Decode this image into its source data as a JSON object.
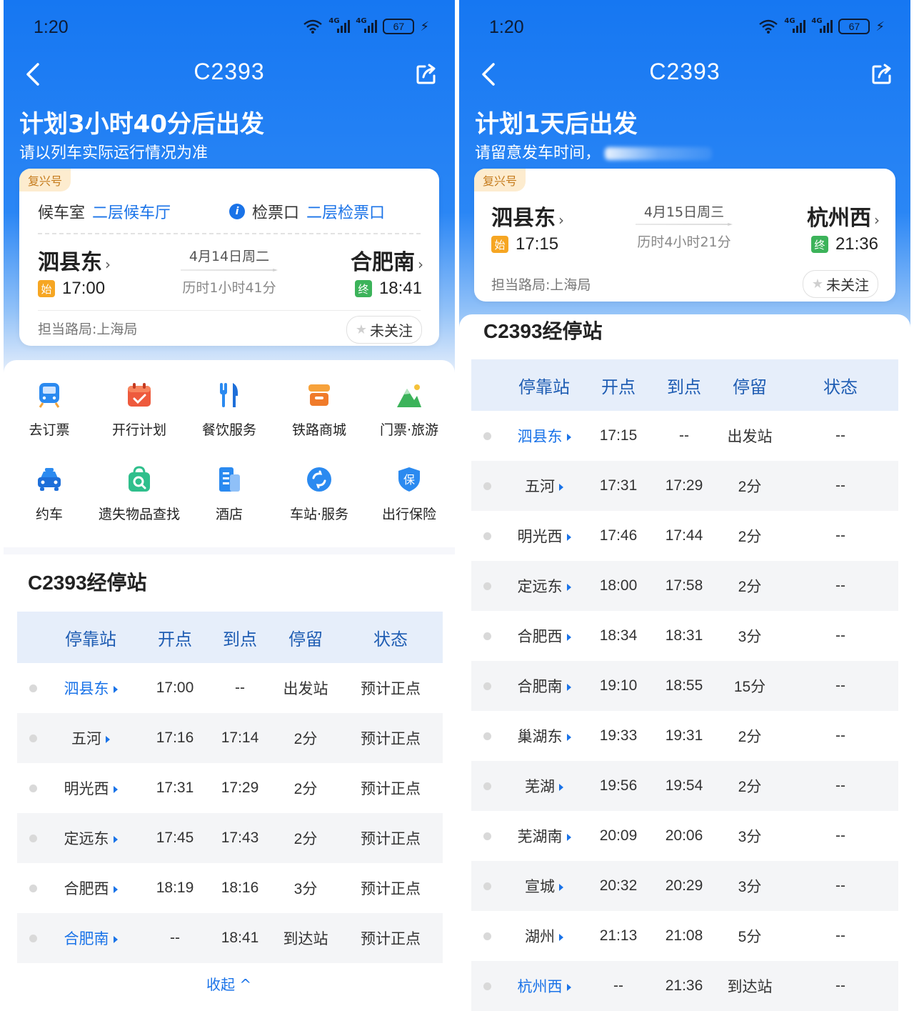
{
  "left": {
    "status": {
      "time": "1:20",
      "battery": "67",
      "net1": "4G",
      "net2": "4G"
    },
    "title": "C2393",
    "headline": "计划3小时40分后出发",
    "subline": "请以列车实际运行情况为准",
    "badge": "复兴号",
    "waiting_label": "候车室",
    "waiting_value": "二层候车厅",
    "gate_label": "检票口",
    "gate_value": "二层检票口",
    "from": {
      "name": "泗县东",
      "tag": "始",
      "time": "17:00"
    },
    "to": {
      "name": "合肥南",
      "tag": "终",
      "time": "18:41"
    },
    "date": "4月14日周二",
    "duration": "历时1小时41分",
    "bureau": "担当路局:上海局",
    "follow": "未关注",
    "services": [
      {
        "label": "去订票",
        "icon": "train-icon"
      },
      {
        "label": "开行计划",
        "icon": "calendar-icon"
      },
      {
        "label": "餐饮服务",
        "icon": "cutlery-icon"
      },
      {
        "label": "铁路商城",
        "icon": "shop-icon"
      },
      {
        "label": "门票·旅游",
        "icon": "mountain-icon"
      },
      {
        "label": "约车",
        "icon": "car-icon"
      },
      {
        "label": "遗失物品查找",
        "icon": "lost-bag-icon"
      },
      {
        "label": "酒店",
        "icon": "hotel-icon"
      },
      {
        "label": "车站·服务",
        "icon": "station-service-icon"
      },
      {
        "label": "出行保险",
        "icon": "insurance-icon"
      }
    ],
    "stops_title": "C2393经停站",
    "headers": [
      "停靠站",
      "开点",
      "到点",
      "停留",
      "状态"
    ],
    "rows": [
      [
        "泗县东",
        "17:00",
        "--",
        "出发站",
        "预计正点"
      ],
      [
        "五河",
        "17:16",
        "17:14",
        "2分",
        "预计正点"
      ],
      [
        "明光西",
        "17:31",
        "17:29",
        "2分",
        "预计正点"
      ],
      [
        "定远东",
        "17:45",
        "17:43",
        "2分",
        "预计正点"
      ],
      [
        "合肥西",
        "18:19",
        "18:16",
        "3分",
        "预计正点"
      ],
      [
        "合肥南",
        "--",
        "18:41",
        "到达站",
        "预计正点"
      ]
    ],
    "collapse": "收起 ^"
  },
  "right": {
    "status": {
      "time": "1:20",
      "battery": "67",
      "net1": "4G",
      "net2": "4G"
    },
    "title": "C2393",
    "headline": "计划1天后出发",
    "subline": "请留意发车时间，",
    "badge": "复兴号",
    "from": {
      "name": "泗县东",
      "tag": "始",
      "time": "17:15"
    },
    "to": {
      "name": "杭州西",
      "tag": "终",
      "time": "21:36"
    },
    "date": "4月15日周三",
    "duration": "历时4小时21分",
    "bureau": "担当路局:上海局",
    "follow": "未关注",
    "stops_title": "C2393经停站",
    "headers": [
      "停靠站",
      "开点",
      "到点",
      "停留",
      "状态"
    ],
    "rows": [
      [
        "泗县东",
        "17:15",
        "--",
        "出发站",
        "--"
      ],
      [
        "五河",
        "17:31",
        "17:29",
        "2分",
        "--"
      ],
      [
        "明光西",
        "17:46",
        "17:44",
        "2分",
        "--"
      ],
      [
        "定远东",
        "18:00",
        "17:58",
        "2分",
        "--"
      ],
      [
        "合肥西",
        "18:34",
        "18:31",
        "3分",
        "--"
      ],
      [
        "合肥南",
        "19:10",
        "18:55",
        "15分",
        "--"
      ],
      [
        "巢湖东",
        "19:33",
        "19:31",
        "2分",
        "--"
      ],
      [
        "芜湖",
        "19:56",
        "19:54",
        "2分",
        "--"
      ],
      [
        "芜湖南",
        "20:09",
        "20:06",
        "3分",
        "--"
      ],
      [
        "宣城",
        "20:32",
        "20:29",
        "3分",
        "--"
      ],
      [
        "湖州",
        "21:13",
        "21:08",
        "5分",
        "--"
      ],
      [
        "杭州西",
        "--",
        "21:36",
        "到达站",
        "--"
      ]
    ]
  },
  "colors": {
    "brand_blue": "#1677f2",
    "link_blue": "#1a73e8",
    "start_tag": "#f6a623",
    "end_tag": "#3cb35a",
    "table_header": "#e6eefa"
  }
}
